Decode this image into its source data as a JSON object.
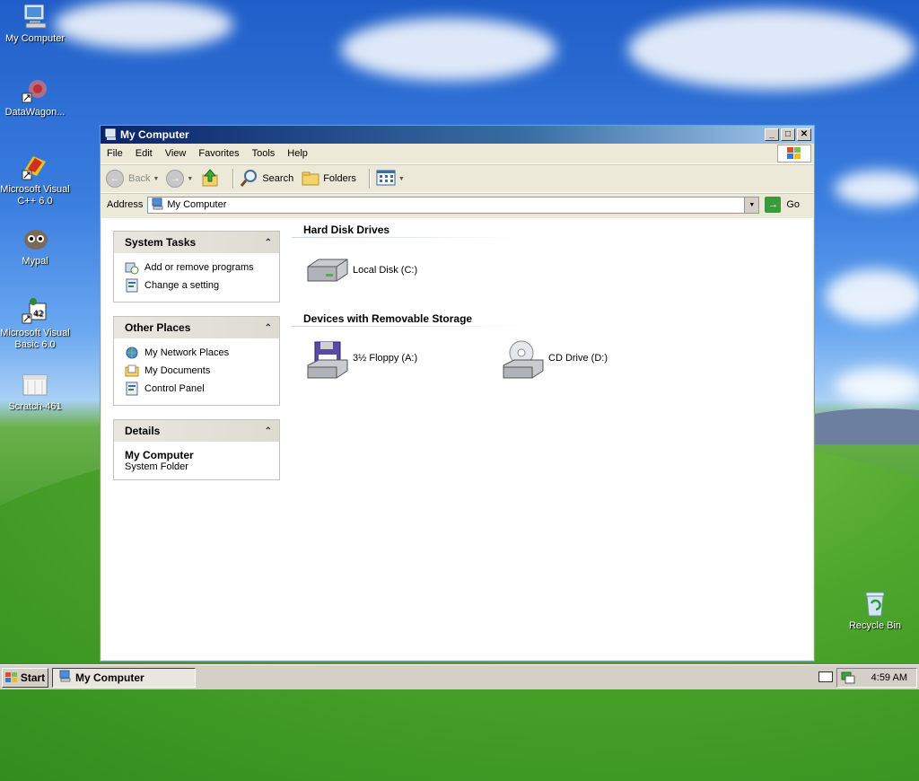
{
  "desktop": {
    "icons": [
      {
        "label": "My Computer"
      },
      {
        "label": "DataWagon..."
      },
      {
        "label": "Microsoft Visual C++ 6.0"
      },
      {
        "label": "Mypal"
      },
      {
        "label": "Microsoft Visual Basic 6.0"
      },
      {
        "label": "Scratch-461"
      },
      {
        "label": "Recycle Bin"
      }
    ]
  },
  "window": {
    "title": "My Computer",
    "menu": [
      "File",
      "Edit",
      "View",
      "Favorites",
      "Tools",
      "Help"
    ],
    "toolbar": {
      "back_label": "Back",
      "search_label": "Search",
      "folders_label": "Folders"
    },
    "address": {
      "label": "Address",
      "value": "My Computer",
      "go_label": "Go"
    },
    "tasks": {
      "system_tasks": {
        "title": "System Tasks",
        "links": [
          "Add or remove programs",
          "Change a setting"
        ]
      },
      "other_places": {
        "title": "Other Places",
        "links": [
          "My Network Places",
          "My Documents",
          "Control Panel"
        ]
      },
      "details": {
        "title": "Details",
        "name": "My Computer",
        "type": "System Folder"
      }
    },
    "groups": {
      "hard_disks": {
        "title": "Hard Disk Drives",
        "items": [
          "Local Disk (C:)"
        ]
      },
      "removable": {
        "title": "Devices with Removable Storage",
        "items": [
          "3½ Floppy (A:)",
          "CD Drive (D:)"
        ]
      }
    }
  },
  "taskbar": {
    "start_label": "Start",
    "task": "My Computer",
    "clock": "4:59 AM"
  },
  "colors": {
    "titlebar_start": "#0a246a",
    "titlebar_end": "#a6caf0",
    "face": "#ece9d8"
  }
}
